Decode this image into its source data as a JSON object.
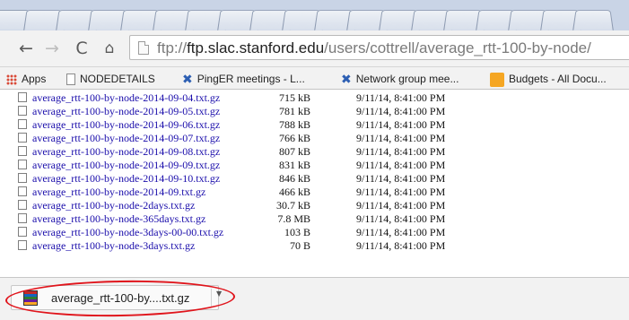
{
  "toolbar": {
    "back_glyph": "←",
    "forward_glyph": "→",
    "reload_glyph": "C",
    "home_glyph": "⌂",
    "url_scheme": "ftp://",
    "url_host": "ftp.slac.stanford.edu",
    "url_path": "/users/cottrell/average_rtt-100-by-node/"
  },
  "bookmarks": {
    "apps": "Apps",
    "items": [
      {
        "label": "NODEDETAILS",
        "icon": "page-icon"
      },
      {
        "label": "PingER meetings - L...",
        "icon": "x-icon"
      },
      {
        "label": "Network group mee...",
        "icon": "x-icon"
      },
      {
        "label": "Budgets - All Docu...",
        "icon": "budget-icon"
      }
    ]
  },
  "listing": {
    "rows": [
      {
        "name": "average_rtt-100-by-node-2014-09-04.txt.gz",
        "size": "715 kB",
        "date": "9/11/14, 8:41:00 PM"
      },
      {
        "name": "average_rtt-100-by-node-2014-09-05.txt.gz",
        "size": "781 kB",
        "date": "9/11/14, 8:41:00 PM"
      },
      {
        "name": "average_rtt-100-by-node-2014-09-06.txt.gz",
        "size": "788 kB",
        "date": "9/11/14, 8:41:00 PM"
      },
      {
        "name": "average_rtt-100-by-node-2014-09-07.txt.gz",
        "size": "766 kB",
        "date": "9/11/14, 8:41:00 PM"
      },
      {
        "name": "average_rtt-100-by-node-2014-09-08.txt.gz",
        "size": "807 kB",
        "date": "9/11/14, 8:41:00 PM"
      },
      {
        "name": "average_rtt-100-by-node-2014-09-09.txt.gz",
        "size": "831 kB",
        "date": "9/11/14, 8:41:00 PM"
      },
      {
        "name": "average_rtt-100-by-node-2014-09-10.txt.gz",
        "size": "846 kB",
        "date": "9/11/14, 8:41:00 PM"
      },
      {
        "name": "average_rtt-100-by-node-2014-09.txt.gz",
        "size": "466 kB",
        "date": "9/11/14, 8:41:00 PM"
      },
      {
        "name": "average_rtt-100-by-node-2days.txt.gz",
        "size": "30.7 kB",
        "date": "9/11/14, 8:41:00 PM"
      },
      {
        "name": "average_rtt-100-by-node-365days.txt.gz",
        "size": "7.8 MB",
        "date": "9/11/14, 8:41:00 PM"
      },
      {
        "name": "average_rtt-100-by-node-3days-00-00.txt.gz",
        "size": "103 B",
        "date": "9/11/14, 8:41:00 PM"
      },
      {
        "name": "average_rtt-100-by-node-3days.txt.gz",
        "size": "70 B",
        "date": "9/11/14, 8:41:00 PM"
      }
    ]
  },
  "downloads": {
    "item_name": "average_rtt-100-by....txt.gz",
    "dropdown_glyph": "▼"
  },
  "colors": {
    "link": "#1a0dab",
    "annotation": "#e0141b"
  }
}
